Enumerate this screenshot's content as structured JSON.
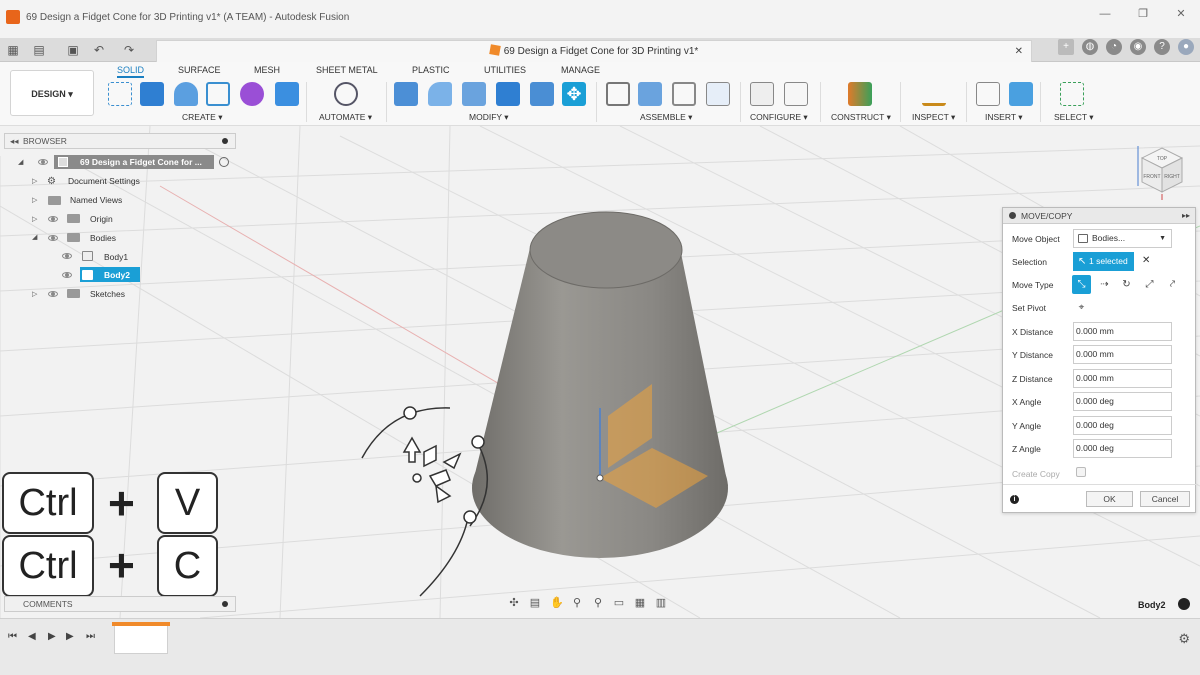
{
  "window": {
    "title": "69 Design a Fidget Cone for 3D Printing v1* (A TEAM) - Autodesk Fusion",
    "doc_tab": "69 Design a Fidget Cone for 3D Printing v1*"
  },
  "ribbon": {
    "workspace": "DESIGN ▾",
    "tabs": [
      "SOLID",
      "SURFACE",
      "MESH",
      "SHEET METAL",
      "PLASTIC",
      "UTILITIES",
      "MANAGE"
    ],
    "groups": [
      "CREATE ▾",
      "AUTOMATE ▾",
      "MODIFY ▾",
      "ASSEMBLE ▾",
      "CONFIGURE ▾",
      "CONSTRUCT ▾",
      "INSPECT ▾",
      "INSERT ▾",
      "SELECT ▾"
    ]
  },
  "browser": {
    "header": "BROWSER",
    "root": "69 Design a Fidget Cone for ...",
    "items": [
      "Document Settings",
      "Named Views",
      "Origin",
      "Bodies",
      "Body1",
      "Body2",
      "Sketches"
    ]
  },
  "comments": {
    "label": "COMMENTS"
  },
  "shortcuts": {
    "row1": [
      "Ctrl",
      "+",
      "V"
    ],
    "row2": [
      "Ctrl",
      "+",
      "C"
    ]
  },
  "move_copy": {
    "title": "MOVE/COPY",
    "move_object_label": "Move Object",
    "move_object_value": "Bodies...",
    "selection_label": "Selection",
    "selection_value": "1 selected",
    "move_type_label": "Move Type",
    "set_pivot_label": "Set Pivot",
    "fields": [
      {
        "label": "X Distance",
        "value": "0.000 mm"
      },
      {
        "label": "Y Distance",
        "value": "0.000 mm"
      },
      {
        "label": "Z Distance",
        "value": "0.000 mm"
      },
      {
        "label": "X Angle",
        "value": "0.000 deg"
      },
      {
        "label": "Y Angle",
        "value": "0.000 deg"
      },
      {
        "label": "Z Angle",
        "value": "0.000 deg"
      }
    ],
    "create_copy_label": "Create Copy",
    "create_copy_checked": false,
    "ok_label": "OK",
    "cancel_label": "Cancel"
  },
  "status": {
    "selection_name": "Body2"
  },
  "viewcube": {
    "faces": [
      "TOP",
      "FRONT",
      "RIGHT"
    ]
  },
  "colors": {
    "accent": "#1a9fd6",
    "cone": "#8c8a86",
    "highlight": "#f0a43a"
  }
}
